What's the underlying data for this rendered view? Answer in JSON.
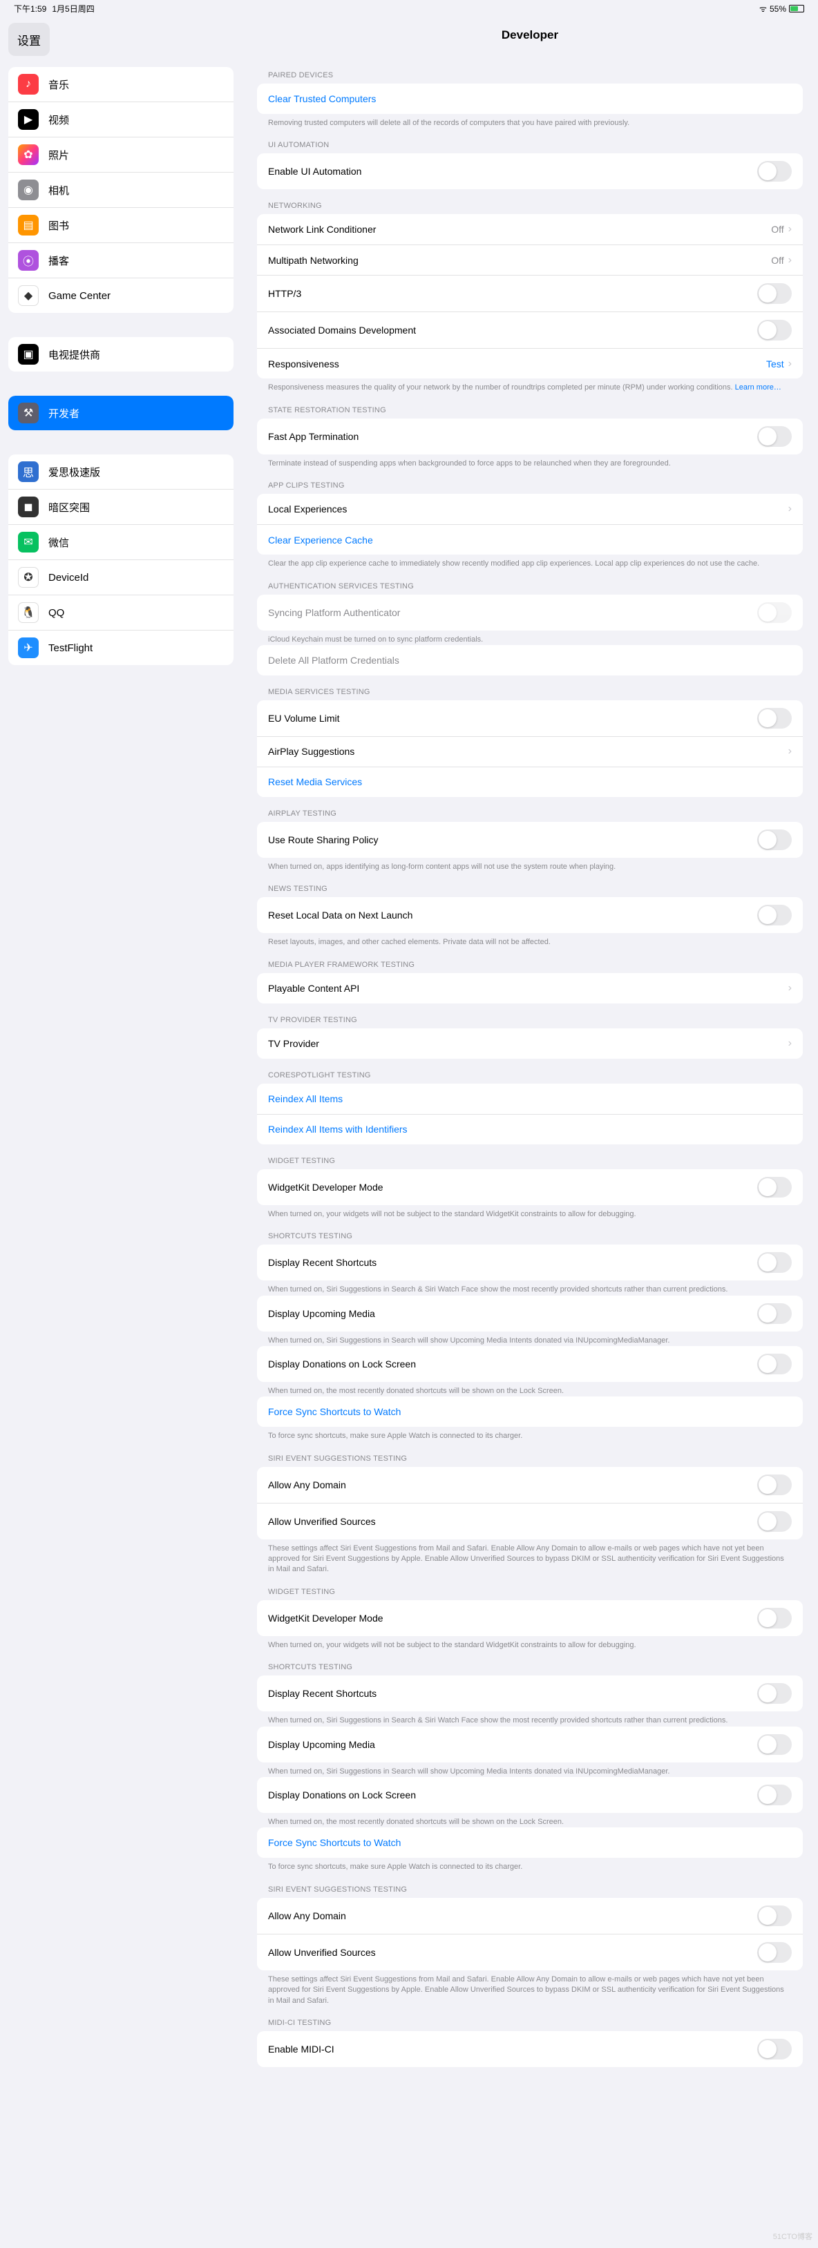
{
  "status": {
    "time": "下午1:59",
    "date": "1月5日周四",
    "battery": "55%"
  },
  "sidebar_title": "设置",
  "sidebar_groups": [
    {
      "items": [
        {
          "label": "音乐",
          "icon": "♪",
          "bg": "#fc3c44"
        },
        {
          "label": "视频",
          "icon": "▶",
          "bg": "#000000"
        },
        {
          "label": "照片",
          "icon": "✿",
          "bg": "linear-gradient(135deg,#ff9a00,#ff3b81,#a033ff)"
        },
        {
          "label": "相机",
          "icon": "◉",
          "bg": "#8e8e93"
        },
        {
          "label": "图书",
          "icon": "▤",
          "bg": "#ff9500"
        },
        {
          "label": "播客",
          "icon": "⦿",
          "bg": "#af52de"
        },
        {
          "label": "Game Center",
          "icon": "◆",
          "bg": "#ffffff"
        }
      ]
    },
    {
      "items": [
        {
          "label": "电视提供商",
          "icon": "▣",
          "bg": "#000000"
        }
      ]
    },
    {
      "items": [
        {
          "label": "开发者",
          "icon": "⚒",
          "bg": "#5e5e6d",
          "selected": true
        }
      ]
    },
    {
      "items": [
        {
          "label": "爱思极速版",
          "icon": "思",
          "bg": "#2f6fd0"
        },
        {
          "label": "暗区突围",
          "icon": "◼",
          "bg": "#323232"
        },
        {
          "label": "微信",
          "icon": "✉",
          "bg": "#07c160"
        },
        {
          "label": "DeviceId",
          "icon": "✪",
          "bg": "#ffffff"
        },
        {
          "label": "QQ",
          "icon": "🐧",
          "bg": "#ffffff"
        },
        {
          "label": "TestFlight",
          "icon": "✈",
          "bg": "#1e8eff"
        }
      ]
    }
  ],
  "page_title": "Developer",
  "sections": [
    {
      "header": "PAIRED DEVICES",
      "rows": [
        {
          "label": "Clear Trusted Computers",
          "type": "link"
        }
      ],
      "footer": "Removing trusted computers will delete all of the records of computers that you have paired with previously."
    },
    {
      "header": "UI AUTOMATION",
      "rows": [
        {
          "label": "Enable UI Automation",
          "type": "toggle",
          "on": false
        }
      ]
    },
    {
      "header": "NETWORKING",
      "rows": [
        {
          "label": "Network Link Conditioner",
          "type": "nav",
          "value": "Off"
        },
        {
          "label": "Multipath Networking",
          "type": "nav",
          "value": "Off"
        },
        {
          "label": "HTTP/3",
          "type": "toggle",
          "on": false
        },
        {
          "label": "Associated Domains Development",
          "type": "toggle",
          "on": false
        },
        {
          "label": "Responsiveness",
          "type": "nav",
          "value": "Test",
          "value_link": true
        }
      ],
      "footer": "Responsiveness measures the quality of your network by the number of roundtrips completed per minute (RPM) under working conditions. ",
      "footer_link": "Learn more…"
    },
    {
      "header": "STATE RESTORATION TESTING",
      "rows": [
        {
          "label": "Fast App Termination",
          "type": "toggle",
          "on": false
        }
      ],
      "footer": "Terminate instead of suspending apps when backgrounded to force apps to be relaunched when they are foregrounded."
    },
    {
      "header": "APP CLIPS TESTING",
      "rows": [
        {
          "label": "Local Experiences",
          "type": "nav"
        },
        {
          "label": "Clear Experience Cache",
          "type": "link"
        }
      ],
      "footer": "Clear the app clip experience cache to immediately show recently modified app clip experiences. Local app clip experiences do not use the cache."
    },
    {
      "header": "AUTHENTICATION SERVICES TESTING",
      "rows": [
        {
          "label": "Syncing Platform Authenticator",
          "type": "toggle",
          "on": false,
          "disabled": true
        }
      ],
      "footer": "iCloud Keychain must be turned on to sync platform credentials."
    },
    {
      "rows": [
        {
          "label": "Delete All Platform Credentials",
          "type": "plain",
          "disabled": true
        }
      ]
    },
    {
      "header": "MEDIA SERVICES TESTING",
      "rows": [
        {
          "label": "EU Volume Limit",
          "type": "toggle",
          "on": false
        },
        {
          "label": "AirPlay Suggestions",
          "type": "nav"
        },
        {
          "label": "Reset Media Services",
          "type": "link"
        }
      ]
    },
    {
      "header": "AIRPLAY TESTING",
      "rows": [
        {
          "label": "Use Route Sharing Policy",
          "type": "toggle",
          "on": false
        }
      ],
      "footer": "When turned on, apps identifying as long-form content apps will not use the system route when playing."
    },
    {
      "header": "NEWS TESTING",
      "rows": [
        {
          "label": "Reset Local Data on Next Launch",
          "type": "toggle",
          "on": false
        }
      ],
      "footer": "Reset layouts, images, and other cached elements. Private data will not be affected."
    },
    {
      "header": "MEDIA PLAYER FRAMEWORK TESTING",
      "rows": [
        {
          "label": "Playable Content API",
          "type": "nav"
        }
      ]
    },
    {
      "header": "TV PROVIDER TESTING",
      "rows": [
        {
          "label": "TV Provider",
          "type": "nav"
        }
      ]
    },
    {
      "header": "CORESPOTLIGHT TESTING",
      "rows": [
        {
          "label": "Reindex All Items",
          "type": "link"
        },
        {
          "label": "Reindex All Items with Identifiers",
          "type": "link"
        }
      ]
    },
    {
      "header": "WIDGET TESTING",
      "rows": [
        {
          "label": "WidgetKit Developer Mode",
          "type": "toggle",
          "on": false
        }
      ],
      "footer": "When turned on, your widgets will not be subject to the standard WidgetKit constraints to allow for debugging."
    },
    {
      "header": "SHORTCUTS TESTING",
      "rows": [
        {
          "label": "Display Recent Shortcuts",
          "type": "toggle",
          "on": false
        }
      ],
      "footer": "When turned on, Siri Suggestions in Search & Siri Watch Face show the most recently provided shortcuts rather than current predictions."
    },
    {
      "rows": [
        {
          "label": "Display Upcoming Media",
          "type": "toggle",
          "on": false
        }
      ],
      "footer": "When turned on, Siri Suggestions in Search will show Upcoming Media Intents donated via INUpcomingMediaManager."
    },
    {
      "rows": [
        {
          "label": "Display Donations on Lock Screen",
          "type": "toggle",
          "on": false
        }
      ],
      "footer": "When turned on, the most recently donated shortcuts will be shown on the Lock Screen."
    },
    {
      "rows": [
        {
          "label": "Force Sync Shortcuts to Watch",
          "type": "link"
        }
      ],
      "footer": "To force sync shortcuts, make sure Apple Watch is connected to its charger."
    },
    {
      "header": "SIRI EVENT SUGGESTIONS TESTING",
      "rows": [
        {
          "label": "Allow Any Domain",
          "type": "toggle",
          "on": false
        },
        {
          "label": "Allow Unverified Sources",
          "type": "toggle",
          "on": false
        }
      ],
      "footer": "These settings affect Siri Event Suggestions from Mail and Safari. Enable Allow Any Domain to allow e-mails or web pages which have not yet been approved for Siri Event Suggestions by Apple. Enable Allow Unverified Sources to bypass DKIM or SSL authenticity verification for Siri Event Suggestions in Mail and Safari."
    },
    {
      "header": "WIDGET TESTING",
      "rows": [
        {
          "label": "WidgetKit Developer Mode",
          "type": "toggle",
          "on": false
        }
      ],
      "footer": "When turned on, your widgets will not be subject to the standard WidgetKit constraints to allow for debugging."
    },
    {
      "header": "SHORTCUTS TESTING",
      "rows": [
        {
          "label": "Display Recent Shortcuts",
          "type": "toggle",
          "on": false
        }
      ],
      "footer": "When turned on, Siri Suggestions in Search & Siri Watch Face show the most recently provided shortcuts rather than current predictions."
    },
    {
      "rows": [
        {
          "label": "Display Upcoming Media",
          "type": "toggle",
          "on": false
        }
      ],
      "footer": "When turned on, Siri Suggestions in Search will show Upcoming Media Intents donated via INUpcomingMediaManager."
    },
    {
      "rows": [
        {
          "label": "Display Donations on Lock Screen",
          "type": "toggle",
          "on": false
        }
      ],
      "footer": "When turned on, the most recently donated shortcuts will be shown on the Lock Screen."
    },
    {
      "rows": [
        {
          "label": "Force Sync Shortcuts to Watch",
          "type": "link"
        }
      ],
      "footer": "To force sync shortcuts, make sure Apple Watch is connected to its charger."
    },
    {
      "header": "SIRI EVENT SUGGESTIONS TESTING",
      "rows": [
        {
          "label": "Allow Any Domain",
          "type": "toggle",
          "on": false
        },
        {
          "label": "Allow Unverified Sources",
          "type": "toggle",
          "on": false
        }
      ],
      "footer": "These settings affect Siri Event Suggestions from Mail and Safari. Enable Allow Any Domain to allow e-mails or web pages which have not yet been approved for Siri Event Suggestions by Apple. Enable Allow Unverified Sources to bypass DKIM or SSL authenticity verification for Siri Event Suggestions in Mail and Safari."
    },
    {
      "header": "MIDI-CI TESTING",
      "rows": [
        {
          "label": "Enable MIDI-CI",
          "type": "toggle",
          "on": false
        }
      ]
    }
  ],
  "watermark": "51CTO博客"
}
